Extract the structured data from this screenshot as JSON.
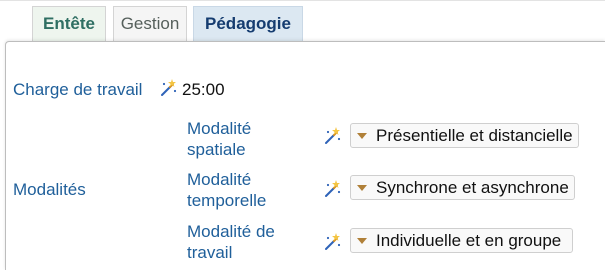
{
  "tabs": [
    {
      "label": "Entête"
    },
    {
      "label": "Gestion"
    },
    {
      "label": "Pédagogie"
    }
  ],
  "workload": {
    "label": "Charge de travail",
    "value": "25:00"
  },
  "modalities": {
    "label": "Modalités",
    "items": [
      {
        "label": "Modalité spatiale",
        "value": "Présentielle et distancielle"
      },
      {
        "label": "Modalité temporelle",
        "value": "Synchrone et asynchrone"
      },
      {
        "label": "Modalité de travail",
        "value": "Individuelle et en groupe"
      }
    ]
  },
  "colors": {
    "label_blue": "#1f5f9a",
    "active_tab_bg": "#dce8f2",
    "dropdown_caret": "#b08038"
  },
  "icons": {
    "wand": "magic-wand-icon"
  }
}
